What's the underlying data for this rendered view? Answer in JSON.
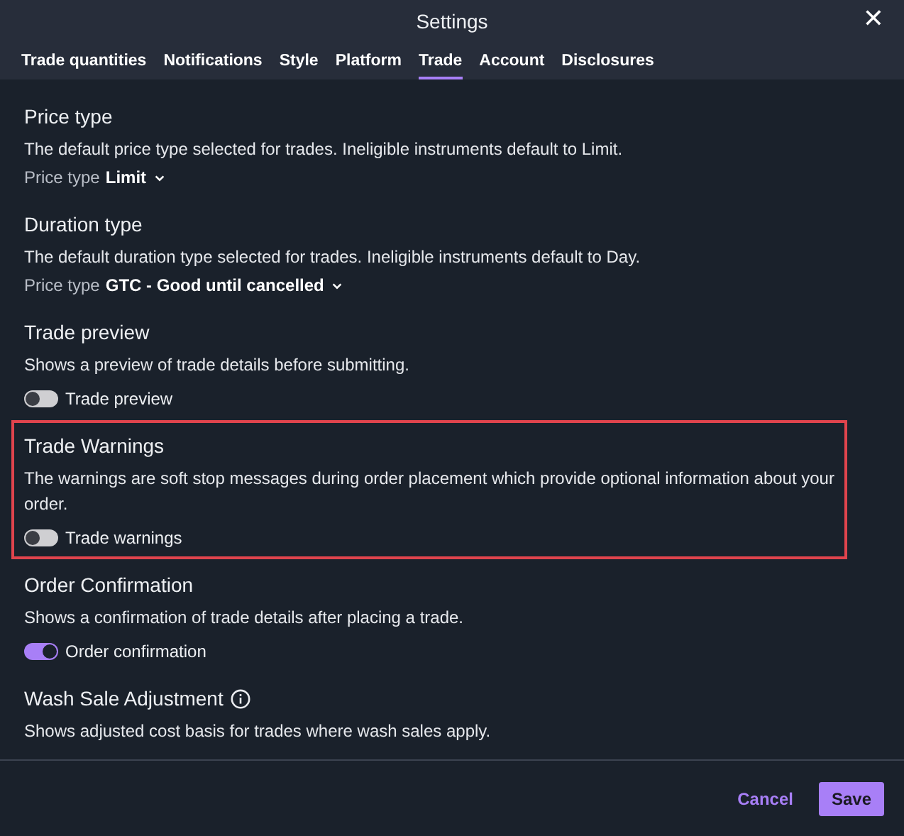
{
  "window": {
    "title": "Settings",
    "close": "✕"
  },
  "tabs": [
    {
      "label": "Trade quantities",
      "selected": false
    },
    {
      "label": "Notifications",
      "selected": false
    },
    {
      "label": "Style",
      "selected": false
    },
    {
      "label": "Platform",
      "selected": false
    },
    {
      "label": "Trade",
      "selected": true
    },
    {
      "label": "Account",
      "selected": false
    },
    {
      "label": "Disclosures",
      "selected": false
    }
  ],
  "sections": [
    {
      "title": "Price type",
      "description": "The default price type selected for trades. Ineligible instruments default to Limit.",
      "kind": "select",
      "label": "Price type",
      "value": "Limit"
    },
    {
      "title": "Duration type",
      "description": "The default duration type selected for trades. Ineligible instruments default to Day.",
      "kind": "select",
      "label": "Price type",
      "value": "GTC - Good until cancelled"
    },
    {
      "title": "Trade preview",
      "description": "Shows a preview of trade details before submitting.",
      "kind": "toggle",
      "label": "Trade preview",
      "on": false
    },
    {
      "title": "Trade Warnings",
      "description": "The warnings are soft stop messages during order placement which provide optional information about your order.",
      "kind": "toggle",
      "label": "Trade warnings",
      "on": false,
      "highlighted": true
    },
    {
      "title": "Order Confirmation",
      "description": "Shows a confirmation of trade details after placing a trade.",
      "kind": "toggle",
      "label": "Order confirmation",
      "on": true
    },
    {
      "title": "Wash Sale Adjustment",
      "info": true,
      "description": "Shows adjusted cost basis for trades where wash sales apply.",
      "kind": "none"
    }
  ],
  "buttons": [
    {
      "label": "Cancel",
      "kind": "text"
    },
    {
      "label": "Save",
      "kind": "primary"
    }
  ]
}
